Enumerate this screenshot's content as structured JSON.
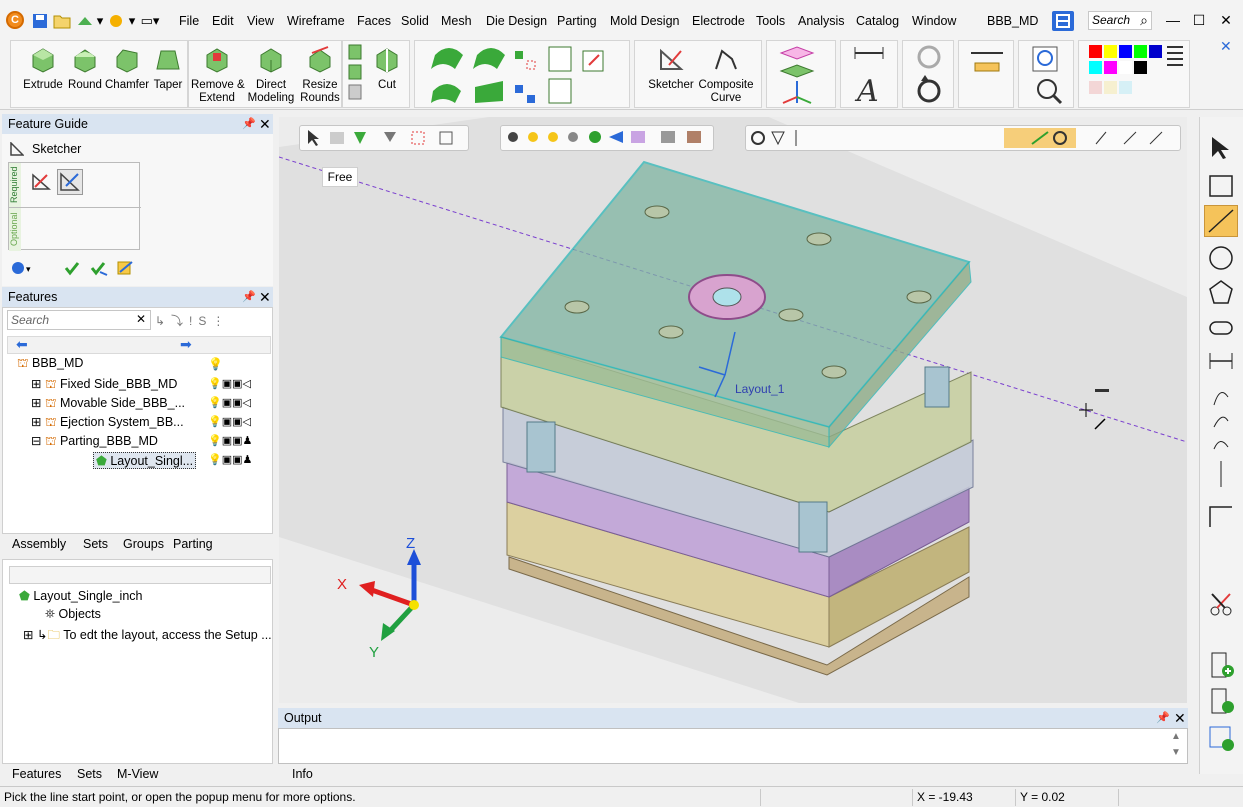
{
  "menubar": {
    "items": [
      "File",
      "Edit",
      "View",
      "Wireframe",
      "Faces",
      "Solid",
      "Mesh",
      "Die Design",
      "Parting",
      "Mold Design",
      "Electrode",
      "Tools",
      "Analysis",
      "Catalog",
      "Window"
    ],
    "doc_title": "BBB_MD",
    "search_placeholder": "Search"
  },
  "ribbon": {
    "solid": [
      {
        "label": "Extrude"
      },
      {
        "label": "Round"
      },
      {
        "label": "Chamfer"
      },
      {
        "label": "Taper"
      }
    ],
    "modify": [
      {
        "label": "Remove &\nExtend"
      },
      {
        "label": "Direct\nModeling"
      },
      {
        "label": "Resize\nRounds"
      }
    ],
    "cut_label": "Cut",
    "sketch": [
      {
        "label": "Sketcher"
      },
      {
        "label": "Composite\nCurve"
      }
    ]
  },
  "feature_guide": {
    "title": "Feature Guide",
    "item": "Sketcher",
    "required_label": "Required",
    "optional_label": "Optional"
  },
  "features_panel": {
    "title": "Features",
    "search_placeholder": "Search",
    "root": "BBB_MD",
    "children": [
      {
        "label": "Fixed Side_BBB_MD"
      },
      {
        "label": "Movable Side_BBB_..."
      },
      {
        "label": "Ejection System_BB..."
      },
      {
        "label": "Parting_BBB_MD"
      }
    ],
    "selected": "Layout_Singl...",
    "tabs": [
      "Assembly",
      "Sets",
      "Groups",
      "Parting"
    ]
  },
  "properties_panel": {
    "root": "Layout_Single_inch",
    "items": [
      "Objects",
      "To edt the layout, access the Setup ..."
    ],
    "tabs": [
      "Features",
      "Sets",
      "M-View"
    ]
  },
  "viewport": {
    "tooltip": "Free",
    "layout_label": "Layout_1",
    "axis_x": "X",
    "axis_y": "Y",
    "axis_z": "Z"
  },
  "output": {
    "title": "Output",
    "tabs": [
      "Info"
    ]
  },
  "status": {
    "prompt": "Pick the line start point, or open the popup menu for more options.",
    "x_coord": "X = -19.43",
    "y_coord": "Y = 0.02"
  },
  "colors": {
    "panel_header": "#d9e4f1",
    "viewport_bg": "#ececec",
    "accent_orange": "#f5a623",
    "accent_blue": "#2b6ad8"
  }
}
